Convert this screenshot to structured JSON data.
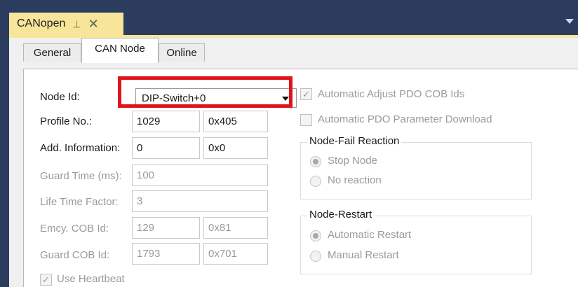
{
  "window": {
    "tab_title": "CANopen",
    "pin_icon": "⊣",
    "close_icon": "✕"
  },
  "tabs": [
    "General",
    "CAN Node",
    "Online"
  ],
  "form": {
    "node_id_label": "Node Id:",
    "node_id_value": "DIP-Switch+0",
    "profile_label": "Profile No.:",
    "profile_dec": "1029",
    "profile_hex": "0x405",
    "addinfo_label": "Add. Information:",
    "addinfo_dec": "0",
    "addinfo_hex": "0x0",
    "guard_time_label": "Guard Time (ms):",
    "guard_time_value": "100",
    "life_time_label": "Life Time Factor:",
    "life_time_value": "3",
    "emcy_label": "Emcy. COB Id:",
    "emcy_dec": "129",
    "emcy_hex": "0x81",
    "guard_cob_label": "Guard COB Id:",
    "guard_cob_dec": "1793",
    "guard_cob_hex": "0x701",
    "use_heartbeat_label": "Use Heartbeat"
  },
  "options": {
    "auto_adjust_label": "Automatic Adjust PDO COB Ids",
    "auto_pdo_label": "Automatic PDO Parameter Download",
    "node_fail_title": "Node-Fail Reaction",
    "stop_node_label": "Stop Node",
    "no_reaction_label": "No reaction",
    "node_restart_title": "Node-Restart",
    "auto_restart_label": "Automatic Restart",
    "manual_restart_label": "Manual Restart"
  },
  "colors": {
    "frame": "#2c3c5e",
    "doc_tab": "#f7e59a",
    "highlight": "#e0141b"
  }
}
